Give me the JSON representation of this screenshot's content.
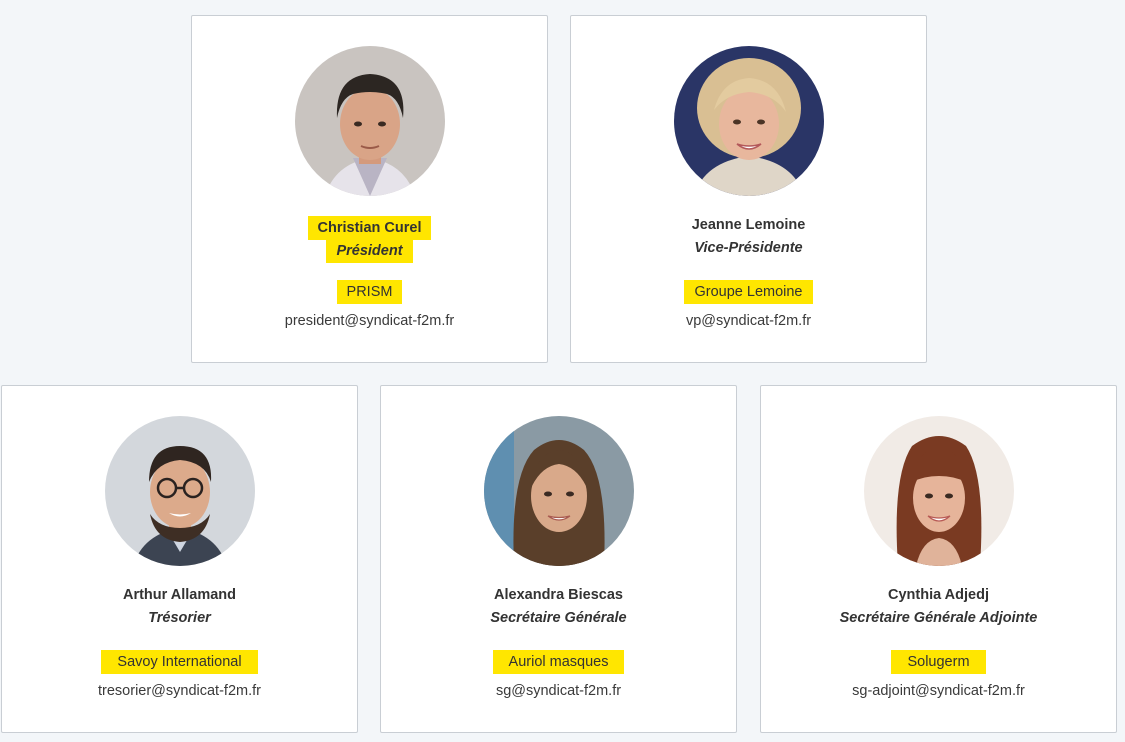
{
  "highlight_color": "#ffe600",
  "members": [
    {
      "name": "Christian Curel",
      "role": "Président",
      "company": "PRISM",
      "email": "president@syndicat-f2m.fr",
      "name_highlighted": true,
      "photo": "portrait-man-dark-hair"
    },
    {
      "name": "Jeanne Lemoine",
      "role": "Vice-Présidente",
      "company": "Groupe Lemoine",
      "email": "vp@syndicat-f2m.fr",
      "name_highlighted": false,
      "photo": "portrait-woman-blonde-hair"
    },
    {
      "name": "Arthur Allamand",
      "role": "Trésorier",
      "company": "Savoy International",
      "email": "tresorier@syndicat-f2m.fr",
      "name_highlighted": false,
      "photo": "portrait-man-glasses-beard"
    },
    {
      "name": "Alexandra Biescas",
      "role": "Secrétaire Générale",
      "company": "Auriol masques",
      "email": "sg@syndicat-f2m.fr",
      "name_highlighted": false,
      "photo": "portrait-woman-brown-hair"
    },
    {
      "name": "Cynthia Adjedj",
      "role": "Secrétaire Générale Adjointe",
      "company": "Solugerm",
      "email": "sg-adjoint@syndicat-f2m.fr",
      "name_highlighted": false,
      "photo": "portrait-woman-auburn-hair-bangs"
    }
  ]
}
